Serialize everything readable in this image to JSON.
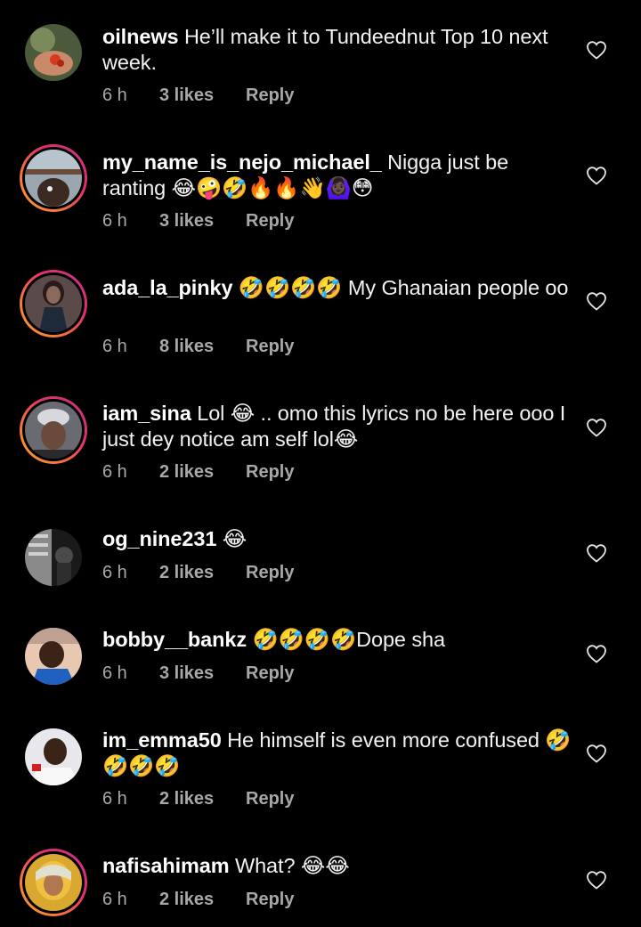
{
  "comments": [
    {
      "username": "oilnews",
      "text": "He’ll make it to Tundeednut Top 10 next week.",
      "time": "6 h",
      "likes": "3 likes",
      "reply": "Reply"
    },
    {
      "username": "my_name_is_nejo_michael_",
      "text": "Nigga just be ranting 😂🤪🤣🔥🔥👋🙆🏿‍♀️😳",
      "time": "6 h",
      "likes": "3 likes",
      "reply": "Reply"
    },
    {
      "username": "ada_la_pinky",
      "text": "🤣🤣🤣🤣 My Ghanaian people oo",
      "time": "6 h",
      "likes": "8 likes",
      "reply": "Reply"
    },
    {
      "username": "iam_sina",
      "text": "Lol 😂 .. omo this lyrics no be here ooo I just dey notice am self lol😂",
      "time": "6 h",
      "likes": "2 likes",
      "reply": "Reply"
    },
    {
      "username": "og_nine231",
      "text": "😂",
      "time": "6 h",
      "likes": "2 likes",
      "reply": "Reply"
    },
    {
      "username": "bobby__bankz",
      "text": "🤣🤣🤣🤣Dope sha",
      "time": "6 h",
      "likes": "3 likes",
      "reply": "Reply"
    },
    {
      "username": "im_emma50",
      "text": "He himself is even more confused 🤣🤣🤣🤣",
      "time": "6 h",
      "likes": "2 likes",
      "reply": "Reply"
    },
    {
      "username": "nafisahimam",
      "text": "What? 😂😂",
      "time": "6 h",
      "likes": "2 likes",
      "reply": "Reply"
    }
  ],
  "colors": {
    "background": "#000000",
    "meta_text": "#a8a8a8",
    "story_ring_start": "#f9a12e",
    "story_ring_end": "#c13584"
  },
  "icons": {
    "like": "heart-outline-icon"
  }
}
